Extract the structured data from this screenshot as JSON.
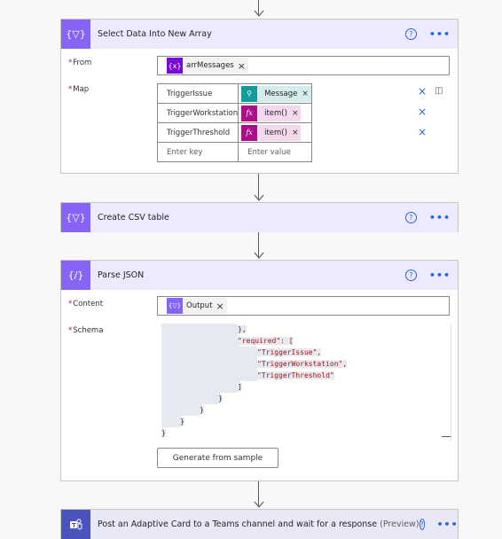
{
  "cards": {
    "select": {
      "title": "Select Data Into New Array",
      "icon": "data-operation-icon",
      "from_label": "From",
      "from_token": {
        "label": "arrMessages",
        "icon": "variable-icon",
        "color": "#770bd6"
      },
      "map_label": "Map",
      "map_rows": [
        {
          "key": "TriggerIssue",
          "value": "Message",
          "token_type": "dynamic",
          "token_icon": "message-icon",
          "icon_color": "#139c9c",
          "bg": "#d4ecec"
        },
        {
          "key": "TriggerWorkstation",
          "value": "item()",
          "token_type": "expression",
          "token_icon": "fx-icon",
          "icon_color": "#ab0d8b",
          "bg": "#f3d8ee"
        },
        {
          "key": "TriggerThreshold",
          "value": "item()",
          "token_type": "expression",
          "token_icon": "fx-icon",
          "icon_color": "#ab0d8b",
          "bg": "#f3d8ee"
        }
      ],
      "new_key_placeholder": "Enter key",
      "new_value_placeholder": "Enter value"
    },
    "csv": {
      "title": "Create CSV table",
      "icon": "data-operation-icon"
    },
    "parse": {
      "title": "Parse JSON",
      "icon": "parse-json-icon",
      "content_label": "Content",
      "content_token": {
        "label": "Output",
        "icon": "data-operation-icon",
        "color": "#8764f5"
      },
      "schema_label": "Schema",
      "schema_lines": [
        "},",
        "\"required\": [",
        "\"TriggerIssue\",",
        "\"TriggerWorkstation\",",
        "\"TriggerThreshold\"",
        "]",
        "}",
        "}",
        "}",
        "}"
      ],
      "generate_button": "Generate from sample"
    },
    "teams": {
      "title": "Post an Adaptive Card to a Teams channel and wait for a response",
      "subtitle": "(Preview)",
      "icon": "teams-icon"
    }
  },
  "common": {
    "help_glyph": "?",
    "more_glyph": "•••",
    "required_mark": "*",
    "remove_glyph": "×"
  },
  "colors": {
    "accent": "#8764f5",
    "header_bg": "#ede9fe",
    "teams": "#4b53bc",
    "link": "#2266e3"
  }
}
